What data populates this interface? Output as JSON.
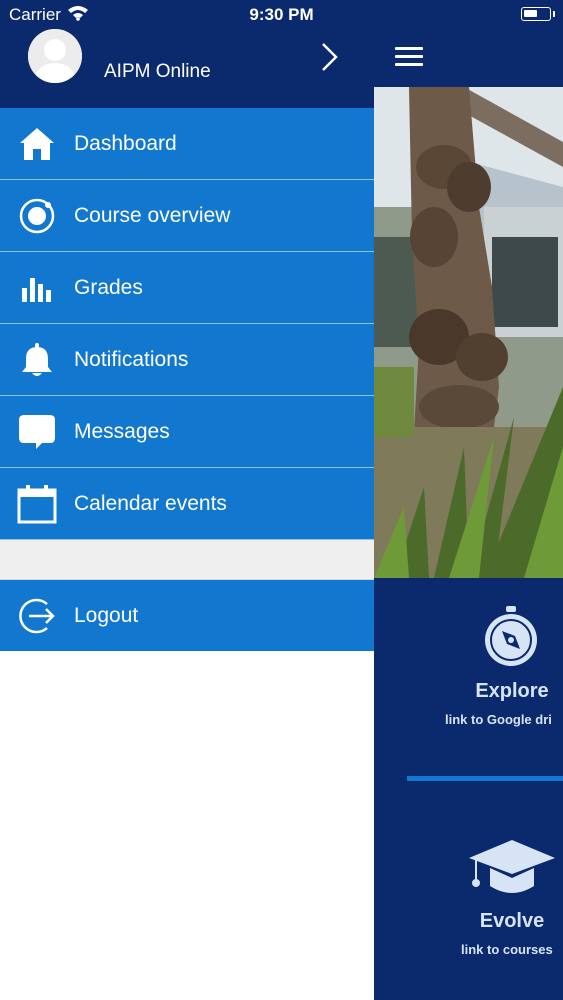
{
  "status_bar": {
    "carrier": "Carrier",
    "time": "9:30 PM",
    "battery_level": 0.55
  },
  "drawer": {
    "user_name": "AIPM Online",
    "menu": [
      {
        "label": "Dashboard",
        "icon": "home-icon"
      },
      {
        "label": "Course overview",
        "icon": "target-icon"
      },
      {
        "label": "Grades",
        "icon": "bar-chart-icon"
      },
      {
        "label": "Notifications",
        "icon": "bell-icon"
      },
      {
        "label": "Messages",
        "icon": "message-bubble-icon"
      },
      {
        "label": "Calendar events",
        "icon": "calendar-icon"
      }
    ],
    "logout": {
      "label": "Logout",
      "icon": "logout-icon"
    }
  },
  "main": {
    "cards": [
      {
        "title": "Explore",
        "subtitle": "link to Google dri",
        "icon": "compass-icon"
      },
      {
        "title": "Evolve",
        "subtitle": "link to courses",
        "icon": "graduation-cap-icon"
      }
    ]
  },
  "colors": {
    "navy": "#0b2a6e",
    "menu_blue": "#1177cf",
    "gap_grey": "#efefef"
  }
}
